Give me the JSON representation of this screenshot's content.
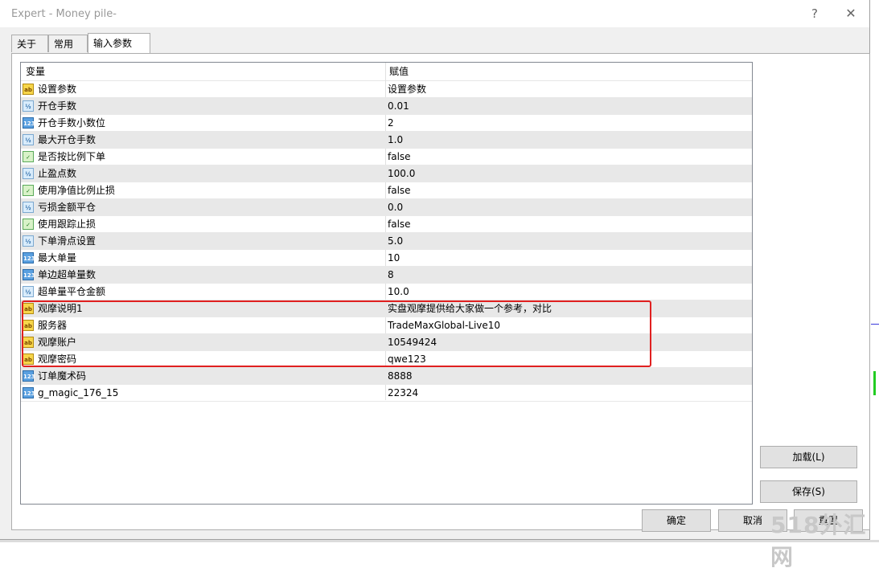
{
  "window": {
    "title": "Expert - Money pile-",
    "help_label": "?",
    "close_label": "✕"
  },
  "tabs": [
    {
      "label": "关于"
    },
    {
      "label": "常用"
    },
    {
      "label": "输入参数"
    }
  ],
  "grid": {
    "col_name": "变量",
    "col_value": "赋值",
    "rows": [
      {
        "type": "string",
        "icon_text": "ab",
        "name": "设置参数",
        "value": "设置参数"
      },
      {
        "type": "double",
        "icon_text": "½",
        "name": "开仓手数",
        "value": "0.01"
      },
      {
        "type": "integer",
        "icon_text": "123",
        "name": "开仓手数小数位",
        "value": "2"
      },
      {
        "type": "double",
        "icon_text": "½",
        "name": "最大开仓手数",
        "value": "1.0"
      },
      {
        "type": "bool",
        "icon_text": "✓",
        "name": "是否按比例下单",
        "value": "false"
      },
      {
        "type": "double",
        "icon_text": "½",
        "name": "止盈点数",
        "value": "100.0"
      },
      {
        "type": "bool",
        "icon_text": "✓",
        "name": "使用净值比例止损",
        "value": "false"
      },
      {
        "type": "double",
        "icon_text": "½",
        "name": "亏损金额平仓",
        "value": "0.0"
      },
      {
        "type": "bool",
        "icon_text": "✓",
        "name": "使用跟踪止损",
        "value": "false"
      },
      {
        "type": "double",
        "icon_text": "½",
        "name": "下单滑点设置",
        "value": "5.0"
      },
      {
        "type": "integer",
        "icon_text": "123",
        "name": "最大单量",
        "value": "10"
      },
      {
        "type": "integer",
        "icon_text": "123",
        "name": "单边超单量数",
        "value": "8"
      },
      {
        "type": "double",
        "icon_text": "½",
        "name": "超单量平仓金额",
        "value": "10.0"
      },
      {
        "type": "string",
        "icon_text": "ab",
        "name": "观摩说明1",
        "value": "实盘观摩提供给大家做一个参考，对比"
      },
      {
        "type": "string",
        "icon_text": "ab",
        "name": "服务器",
        "value": "TradeMaxGlobal-Live10"
      },
      {
        "type": "string",
        "icon_text": "ab",
        "name": "观摩账户",
        "value": "10549424"
      },
      {
        "type": "string",
        "icon_text": "ab",
        "name": "观摩密码",
        "value": "qwe123"
      },
      {
        "type": "integer",
        "icon_text": "123",
        "name": "订单魔术码",
        "value": "8888"
      },
      {
        "type": "integer",
        "icon_text": "123",
        "name": "g_magic_176_15",
        "value": "22324"
      }
    ]
  },
  "buttons": {
    "load": "加载(L)",
    "save": "保存(S)",
    "ok": "确定",
    "cancel": "取消",
    "reset": "重置"
  },
  "watermark": "518外汇网",
  "colors": {
    "highlight_border": "#e02020",
    "alt_row": "#e8e8e8",
    "title_text": "#999999"
  }
}
